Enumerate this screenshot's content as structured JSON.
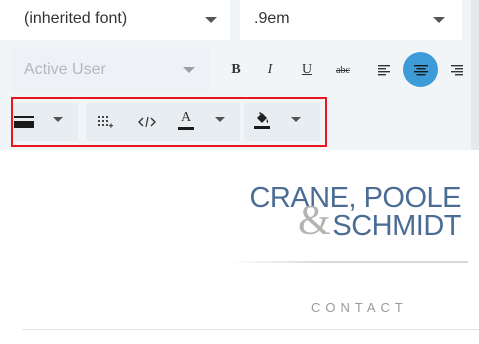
{
  "toolbar": {
    "font_family": {
      "value": "(inherited font)"
    },
    "font_size": {
      "value": ".9em"
    },
    "user_select": {
      "value": "Active User"
    },
    "format": {
      "bold": "B",
      "italic": "I",
      "underline": "U",
      "strike": "abc"
    },
    "alignment": {
      "active": "center"
    },
    "font_color_glyph": "A",
    "icons": {
      "line_style": "line-style-icon",
      "insert_table": "table-grid-icon",
      "code_view": "code-icon",
      "font_color": "font-color-icon",
      "background_color": "fill-bucket-icon"
    },
    "colors": {
      "accent": "#3d9bd8",
      "highlight_border": "#e8171f",
      "toolbar_bg": "#f2f5f8"
    }
  },
  "document": {
    "logo": {
      "line1": "CRANE, POOLE",
      "ampersand": "&",
      "line2": "SCHMIDT",
      "color": "#4b6d95"
    },
    "section_title": "CONTACT"
  }
}
